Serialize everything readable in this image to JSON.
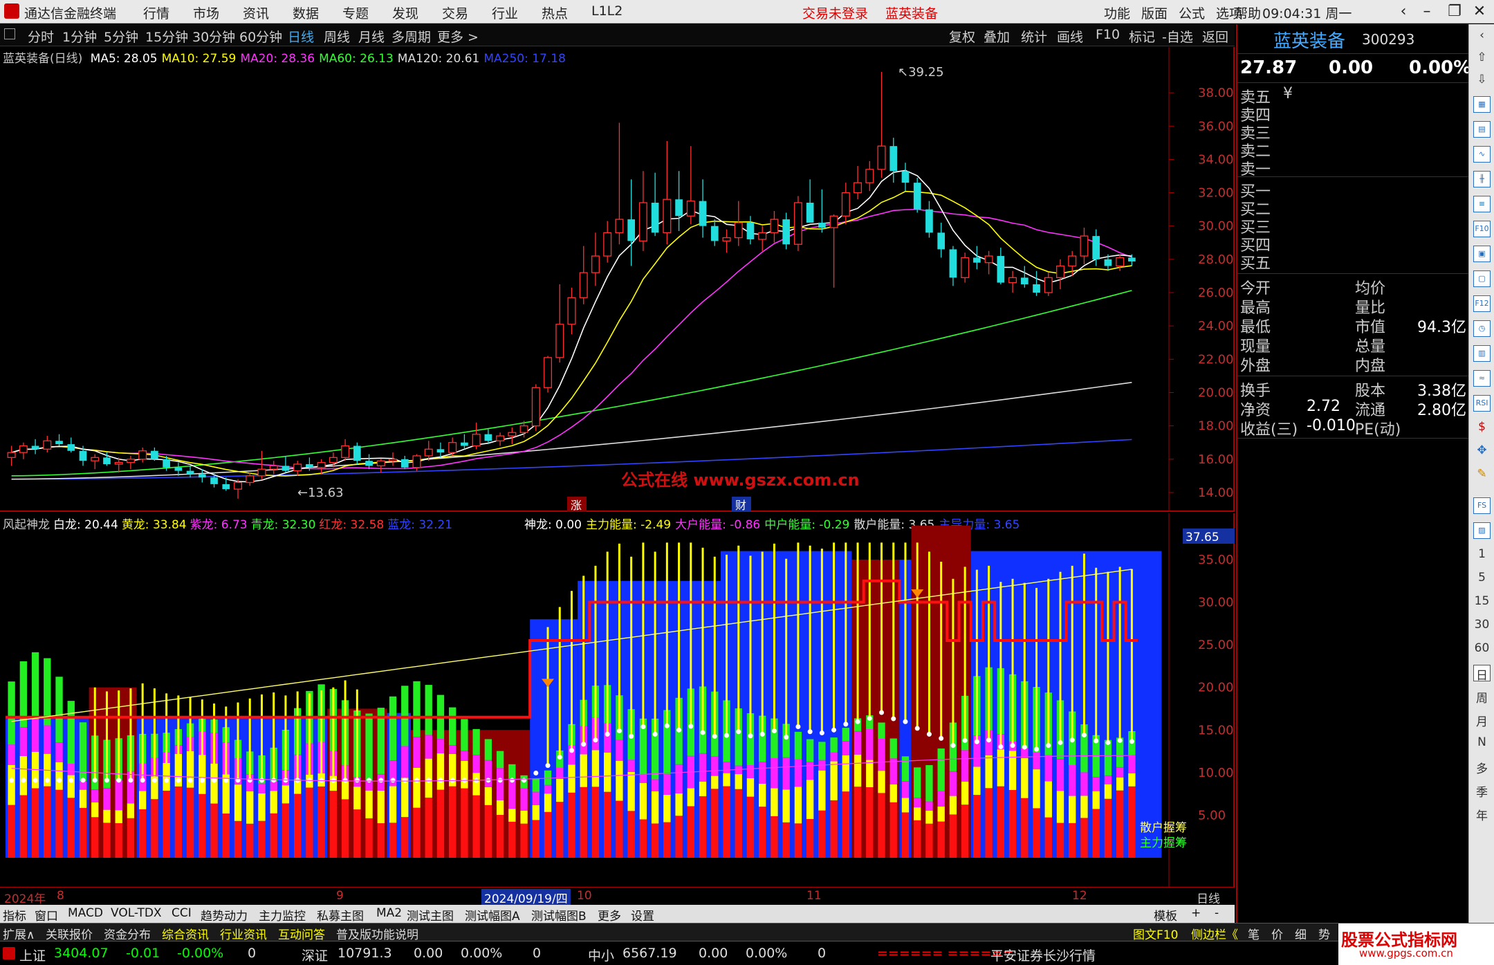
{
  "app": {
    "title": "通达信金融终端",
    "clock": "09:04:31 周一"
  },
  "menu": [
    "行情",
    "市场",
    "资讯",
    "数据",
    "专题",
    "发现",
    "交易",
    "行业",
    "热点",
    "L1L2"
  ],
  "menu_status": {
    "trade": "交易未登录",
    "stock": "蓝英装备"
  },
  "menu_right": [
    "功能",
    "版面",
    "公式",
    "选项",
    "帮助"
  ],
  "periods": [
    "分时",
    "1分钟",
    "5分钟",
    "15分钟",
    "30分钟",
    "60分钟",
    "日线",
    "周线",
    "月线",
    "多周期",
    "更多 >"
  ],
  "active_period": "日线",
  "chart_tools": [
    "复权",
    "叠加",
    "统计",
    "画线",
    "F10",
    "标记",
    "-自选",
    "返回"
  ],
  "stock": {
    "name": "蓝英装备",
    "code": "300293",
    "price": "27.87",
    "change": "0.00",
    "pct": "0.00%"
  },
  "main_legend": [
    {
      "text": "蓝英装备(日线) ",
      "color": "#c8c8c8"
    },
    {
      "text": "MA5: 28.05",
      "color": "#ffffff"
    },
    {
      "text": "MA10: 27.59",
      "color": "#ffff00"
    },
    {
      "text": "MA20: 28.36",
      "color": "#ff33ff"
    },
    {
      "text": "MA60: 26.13",
      "color": "#33ff33"
    },
    {
      "text": "MA120: 20.61",
      "color": "#dddddd"
    },
    {
      "text": "MA250: 17.18",
      "color": "#3344ff"
    }
  ],
  "price_axis": [
    "38.00",
    "36.00",
    "34.00",
    "32.00",
    "30.00",
    "28.00",
    "26.00",
    "24.00",
    "22.00",
    "20.00",
    "18.00",
    "16.00",
    "14.00"
  ],
  "annotations": {
    "high": "39.25",
    "low": "13.63",
    "watermark": "公式在线 www.gszx.com.cn",
    "marker_zhang": "涨",
    "marker_cai": "财"
  },
  "ind_legend": [
    {
      "text": "风起神龙",
      "color": "#c8c8c8"
    },
    {
      "text": "白龙: 20.44",
      "color": "#ffffff"
    },
    {
      "text": "黄龙: 33.84",
      "color": "#ffff00"
    },
    {
      "text": "紫龙: 6.73",
      "color": "#ff33ff"
    },
    {
      "text": "青龙: 32.30",
      "color": "#33ff33"
    },
    {
      "text": "红龙: 32.58",
      "color": "#ff3333"
    },
    {
      "text": "蓝龙: 32.21",
      "color": "#3344ff"
    }
  ],
  "ind_legend2": [
    {
      "text": "神龙: 0.00",
      "color": "#ffffff"
    },
    {
      "text": "主力能量: -2.49",
      "color": "#ffff00"
    },
    {
      "text": "大户能量: -0.86",
      "color": "#ff33ff"
    },
    {
      "text": "中户能量: -0.29",
      "color": "#33ff33"
    },
    {
      "text": "散户能量: 3.65",
      "color": "#dddddd"
    },
    {
      "text": "主导力量: 3.65",
      "color": "#3344ff"
    }
  ],
  "ind_axis": [
    "35.00",
    "30.00",
    "25.00",
    "20.00",
    "15.00",
    "10.00",
    "5.00"
  ],
  "ind_axis_flag": "37.65",
  "ind_labels": {
    "a": "散户握筹",
    "b": "主力握筹"
  },
  "date_axis": {
    "year": "2024年",
    "m8": "8",
    "m9": "9",
    "cursor": "2024/09/19/四",
    "m10": "10",
    "m11": "11",
    "m12": "12",
    "period": "日线"
  },
  "bottom_tabs": [
    "指标",
    "窗口",
    "MACD",
    "VOL-TDX",
    "CCI",
    "趋势动力",
    "主力监控",
    "私募主图",
    "MA2",
    "测试主图",
    "测试幅图A",
    "测试幅图B",
    "更多",
    "设置"
  ],
  "bottom_tabs_right": [
    "模板",
    "+",
    "-"
  ],
  "info_tabs": [
    "扩展∧",
    "关联报价",
    "资金分布",
    "综合资讯",
    "行业资讯",
    "互动问答",
    "普及版功能说明"
  ],
  "info_tabs_right": [
    "图文F10",
    "侧边栏《",
    "笔",
    "价",
    "细",
    "势"
  ],
  "status": {
    "sh_label": "上证",
    "sh_val": "3404.07",
    "sh_chg": "-0.01",
    "sh_pct": "-0.00%",
    "sh_vol": "0",
    "sz_label": "深证",
    "sz_val": "10791.3",
    "sz_chg": "0.00",
    "sz_pct": "0.00%",
    "sz_vol": "0",
    "zx_label": "中小",
    "zx_val": "6567.19",
    "zx_chg": "0.00",
    "zx_pct": "0.00%",
    "zx_vol": "0",
    "ticker": "====== ======",
    "broker": "平安证券长沙行情"
  },
  "orderbook": {
    "sell": [
      "卖五",
      "卖四",
      "卖三",
      "卖二",
      "卖一"
    ],
    "buy": [
      "买一",
      "买二",
      "买三",
      "买四",
      "买五"
    ],
    "unit": "¥"
  },
  "quote": [
    {
      "l": "今开",
      "v": "",
      "l2": "均价",
      "v2": ""
    },
    {
      "l": "最高",
      "v": "",
      "l2": "量比",
      "v2": ""
    },
    {
      "l": "最低",
      "v": "",
      "l2": "市值",
      "v2": "94.3亿"
    },
    {
      "l": "现量",
      "v": "",
      "l2": "总量",
      "v2": ""
    },
    {
      "l": "外盘",
      "v": "",
      "l2": "内盘",
      "v2": ""
    }
  ],
  "finance": [
    {
      "l": "换手",
      "v": "",
      "l2": "股本",
      "v2": "3.38亿"
    },
    {
      "l": "净资",
      "v": "2.72",
      "l2": "流通",
      "v2": "2.80亿"
    },
    {
      "l": "收益(三)",
      "v": "-0.010",
      "l2": "PE(动)",
      "v2": ""
    }
  ],
  "side_tools": [
    "1",
    "5",
    "15",
    "30",
    "60",
    "日",
    "周",
    "月",
    "N",
    "多",
    "季",
    "年"
  ],
  "watermark_corner": {
    "title": "股票公式指标网",
    "url": "www.gpgs.com.cn"
  },
  "chart_data": {
    "type": "candlestick",
    "title": "蓝英装备(日线)",
    "ylim": [
      13,
      39.5
    ],
    "candles": [
      [
        16.1,
        16.8,
        15.6,
        16.4
      ],
      [
        16.4,
        17.0,
        16.0,
        16.8
      ],
      [
        16.8,
        17.2,
        16.3,
        16.6
      ],
      [
        16.6,
        17.4,
        16.4,
        17.1
      ],
      [
        17.1,
        17.5,
        16.8,
        16.9
      ],
      [
        16.9,
        17.3,
        16.4,
        16.5
      ],
      [
        16.5,
        16.8,
        15.6,
        15.9
      ],
      [
        15.9,
        16.3,
        15.4,
        16.1
      ],
      [
        16.1,
        16.4,
        15.6,
        15.7
      ],
      [
        15.7,
        16.1,
        15.2,
        15.8
      ],
      [
        15.8,
        16.2,
        15.4,
        16.0
      ],
      [
        16.0,
        16.7,
        15.8,
        16.5
      ],
      [
        16.5,
        16.7,
        15.9,
        16.0
      ],
      [
        16.0,
        16.2,
        15.3,
        15.5
      ],
      [
        15.5,
        15.8,
        15.0,
        15.3
      ],
      [
        15.3,
        15.6,
        14.9,
        15.1
      ],
      [
        15.1,
        15.4,
        14.6,
        14.9
      ],
      [
        14.9,
        15.2,
        14.3,
        14.5
      ],
      [
        14.5,
        14.9,
        14.1,
        14.2
      ],
      [
        14.2,
        14.8,
        13.63,
        14.6
      ],
      [
        14.6,
        15.2,
        14.4,
        15.0
      ],
      [
        15.0,
        16.5,
        14.8,
        15.4
      ],
      [
        15.4,
        15.9,
        15.1,
        15.6
      ],
      [
        15.6,
        16.2,
        15.2,
        15.3
      ],
      [
        15.3,
        15.9,
        15.0,
        15.7
      ],
      [
        15.7,
        16.1,
        15.3,
        15.5
      ],
      [
        15.5,
        16.0,
        15.1,
        15.8
      ],
      [
        15.8,
        16.4,
        15.5,
        16.1
      ],
      [
        16.1,
        17.2,
        15.9,
        16.8
      ],
      [
        16.8,
        17.0,
        15.7,
        15.9
      ],
      [
        15.9,
        16.3,
        15.4,
        15.6
      ],
      [
        15.6,
        16.0,
        15.2,
        15.9
      ],
      [
        15.9,
        16.4,
        15.6,
        16.0
      ],
      [
        16.0,
        16.2,
        15.4,
        15.5
      ],
      [
        15.5,
        16.3,
        15.3,
        16.2
      ],
      [
        16.2,
        17.1,
        15.9,
        16.6
      ],
      [
        16.6,
        17.0,
        16.1,
        16.4
      ],
      [
        16.4,
        17.3,
        16.2,
        17.0
      ],
      [
        17.0,
        17.5,
        16.6,
        16.8
      ],
      [
        16.8,
        18.2,
        16.6,
        17.5
      ],
      [
        17.5,
        17.8,
        16.9,
        17.1
      ],
      [
        17.1,
        17.6,
        16.8,
        17.4
      ],
      [
        17.4,
        17.9,
        16.9,
        17.6
      ],
      [
        17.6,
        18.3,
        17.3,
        18.0
      ],
      [
        18.0,
        20.5,
        17.7,
        20.3
      ],
      [
        20.3,
        22.2,
        20.0,
        22.1
      ],
      [
        22.1,
        26.5,
        21.8,
        24.1
      ],
      [
        24.1,
        26.3,
        23.5,
        25.7
      ],
      [
        25.7,
        28.8,
        25.3,
        27.2
      ],
      [
        27.2,
        29.6,
        26.4,
        28.2
      ],
      [
        28.2,
        30.3,
        27.8,
        29.6
      ],
      [
        29.6,
        36.2,
        28.9,
        30.4
      ],
      [
        30.4,
        32.8,
        27.6,
        29.1
      ],
      [
        29.1,
        33.3,
        28.5,
        31.4
      ],
      [
        31.4,
        33.2,
        29.4,
        29.6
      ],
      [
        29.6,
        35.1,
        28.9,
        31.6
      ],
      [
        31.6,
        33.3,
        29.7,
        30.6
      ],
      [
        30.6,
        34.8,
        30.1,
        31.5
      ],
      [
        31.5,
        32.8,
        29.3,
        30.0
      ],
      [
        30.0,
        30.4,
        28.8,
        29.1
      ],
      [
        29.1,
        29.8,
        28.4,
        29.3
      ],
      [
        29.3,
        31.5,
        28.8,
        30.2
      ],
      [
        30.2,
        30.6,
        28.9,
        29.2
      ],
      [
        29.2,
        30.0,
        28.5,
        29.6
      ],
      [
        29.6,
        30.9,
        29.0,
        30.4
      ],
      [
        30.4,
        30.8,
        28.6,
        28.9
      ],
      [
        28.9,
        31.8,
        28.5,
        31.4
      ],
      [
        31.4,
        32.8,
        30.6,
        30.2
      ],
      [
        30.2,
        32.2,
        29.6,
        29.9
      ],
      [
        29.9,
        30.7,
        26.3,
        30.6
      ],
      [
        30.6,
        32.6,
        30.1,
        32.0
      ],
      [
        32.0,
        33.6,
        31.6,
        32.6
      ],
      [
        32.6,
        33.9,
        32.1,
        33.4
      ],
      [
        33.4,
        39.25,
        32.9,
        34.8
      ],
      [
        34.8,
        35.3,
        32.6,
        33.3
      ],
      [
        33.3,
        33.8,
        32.1,
        32.6
      ],
      [
        32.6,
        32.9,
        30.8,
        31.0
      ],
      [
        31.0,
        31.5,
        29.3,
        29.6
      ],
      [
        29.6,
        30.2,
        28.1,
        28.6
      ],
      [
        28.6,
        28.8,
        26.4,
        26.9
      ],
      [
        26.9,
        28.4,
        26.6,
        28.1
      ],
      [
        28.1,
        28.8,
        27.4,
        27.8
      ],
      [
        27.8,
        28.5,
        27.1,
        28.2
      ],
      [
        28.2,
        28.7,
        26.5,
        26.6
      ],
      [
        26.6,
        27.3,
        26.0,
        26.9
      ],
      [
        26.9,
        27.6,
        26.3,
        26.5
      ],
      [
        26.5,
        27.3,
        25.8,
        26.0
      ],
      [
        26.0,
        27.2,
        25.8,
        26.9
      ],
      [
        26.9,
        28.0,
        26.2,
        27.6
      ],
      [
        27.6,
        28.5,
        27.0,
        28.2
      ],
      [
        28.2,
        29.9,
        27.7,
        29.4
      ],
      [
        29.4,
        29.8,
        27.6,
        28.0
      ],
      [
        28.0,
        28.3,
        27.3,
        27.6
      ],
      [
        27.6,
        28.3,
        27.3,
        28.1
      ],
      [
        28.1,
        28.3,
        27.6,
        27.87
      ]
    ],
    "ma_endpoints": {
      "MA60": [
        15.0,
        26.13
      ],
      "MA120": [
        14.8,
        20.61
      ],
      "MA250": [
        14.8,
        17.18
      ]
    }
  }
}
